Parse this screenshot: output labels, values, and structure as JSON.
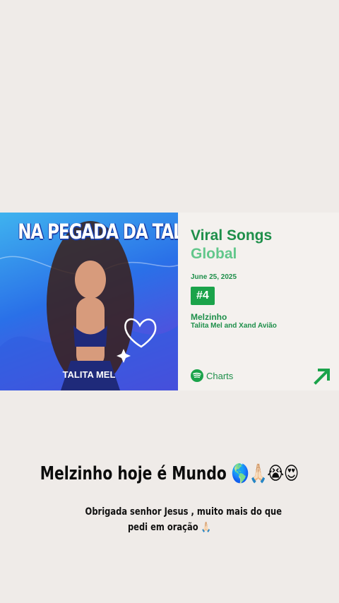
{
  "cover": {
    "title": "NA PEGADA DA TALITA",
    "artist": "TALITA MEL"
  },
  "chart": {
    "title": "Viral Songs",
    "region": "Global",
    "date": "June 25, 2025",
    "rank": "#4",
    "song": "Melzinho",
    "artists": "Talita Mel and Xand Avião",
    "brand_label": "Charts"
  },
  "post": {
    "headline": "Melzinho hoje é Mundo 🌎🙏🏻😭😍",
    "caption_line1": "Obrigada senhor Jesus , muito mais do que",
    "caption_line2": "pedi em oração 🙏🏻"
  },
  "colors": {
    "accent_green": "#1aa34a",
    "text_green": "#1e8f4a",
    "light_green": "#62c78b",
    "background": "#efebe8"
  },
  "icons": {
    "brand": "spotify-icon",
    "share": "arrow-up-right-icon"
  }
}
